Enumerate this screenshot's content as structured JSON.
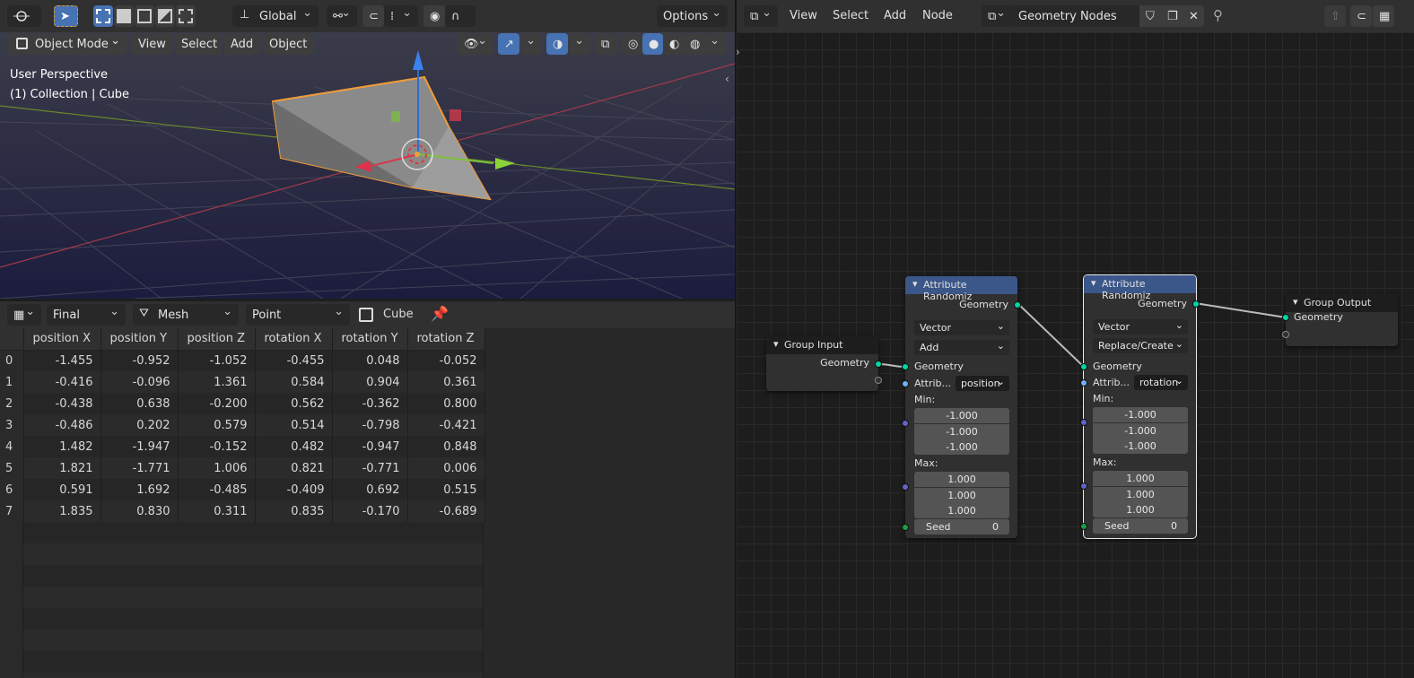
{
  "viewport_header": {
    "orientation": "Global",
    "options": "Options"
  },
  "viewport_toolbar": {
    "mode": "Object Mode",
    "menus": [
      "View",
      "Select",
      "Add",
      "Object"
    ]
  },
  "viewport_overlay": {
    "line1": "User Perspective",
    "line2": "(1) Collection | Cube"
  },
  "spreadsheet": {
    "evaluation": "Final",
    "component": "Mesh",
    "domain": "Point",
    "object": "Cube",
    "columns": [
      "position X",
      "position Y",
      "position Z",
      "rotation X",
      "rotation Y",
      "rotation Z"
    ],
    "rows": [
      [
        "0",
        "-1.455",
        "-0.952",
        "-1.052",
        "-0.455",
        "0.048",
        "-0.052"
      ],
      [
        "1",
        "-0.416",
        "-0.096",
        "1.361",
        "0.584",
        "0.904",
        "0.361"
      ],
      [
        "2",
        "-0.438",
        "0.638",
        "-0.200",
        "0.562",
        "-0.362",
        "0.800"
      ],
      [
        "3",
        "-0.486",
        "0.202",
        "0.579",
        "0.514",
        "-0.798",
        "-0.421"
      ],
      [
        "4",
        "1.482",
        "-1.947",
        "-0.152",
        "0.482",
        "-0.947",
        "0.848"
      ],
      [
        "5",
        "1.821",
        "-1.771",
        "1.006",
        "0.821",
        "-0.771",
        "0.006"
      ],
      [
        "6",
        "0.591",
        "1.692",
        "-0.485",
        "-0.409",
        "0.692",
        "0.515"
      ],
      [
        "7",
        "1.835",
        "0.830",
        "0.311",
        "0.835",
        "-0.170",
        "-0.689"
      ]
    ]
  },
  "node_editor": {
    "menus": [
      "View",
      "Select",
      "Add",
      "Node"
    ],
    "tree_name": "Geometry Nodes",
    "group_input": {
      "title": "Group Input",
      "output": "Geometry"
    },
    "group_output": {
      "title": "Group Output",
      "input": "Geometry"
    },
    "rand1": {
      "title": "Attribute Randomiz",
      "out": "Geometry",
      "type": "Vector",
      "op": "Add",
      "geo": "Geometry",
      "attr_label": "Attrib...",
      "attr": "position",
      "min_label": "Min:",
      "min": [
        "-1.000",
        "-1.000",
        "-1.000"
      ],
      "max_label": "Max:",
      "max": [
        "1.000",
        "1.000",
        "1.000"
      ],
      "seed_label": "Seed",
      "seed": "0"
    },
    "rand2": {
      "title": "Attribute Randomiz",
      "out": "Geometry",
      "type": "Vector",
      "op": "Replace/Create",
      "geo": "Geometry",
      "attr_label": "Attrib...",
      "attr": "rotation",
      "min_label": "Min:",
      "min": [
        "-1.000",
        "-1.000",
        "-1.000"
      ],
      "max_label": "Max:",
      "max": [
        "1.000",
        "1.000",
        "1.000"
      ],
      "seed_label": "Seed",
      "seed": "0"
    }
  },
  "colors": {
    "geometry_socket": "#00d6a3",
    "vector_socket": "#6363c7",
    "string_socket": "#70b2ff",
    "int_socket": "#1d9c43",
    "node_header": "#3b5689",
    "selection": "#f29c37"
  }
}
